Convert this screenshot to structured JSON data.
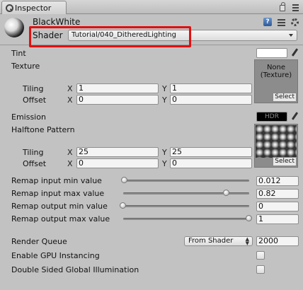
{
  "tab": {
    "title": "Inspector",
    "icon": "inspector-icon"
  },
  "material": {
    "name": "BlackWhite",
    "shader_label": "Shader",
    "shader_value": "Tutorial/040_DitheredLighting"
  },
  "properties": {
    "tint": {
      "label": "Tint",
      "color": "#ffffff"
    },
    "texture": {
      "label": "Texture",
      "slot_text": "None\n(Texture)",
      "select_label": "Select",
      "tiling_label": "Tiling",
      "tiling_x": "1",
      "tiling_y": "1",
      "offset_label": "Offset",
      "offset_x": "0",
      "offset_y": "0"
    },
    "emission": {
      "label": "Emission",
      "hdr_text": "HDR",
      "color": "#000000"
    },
    "halftone": {
      "label": "Halftone Pattern",
      "select_label": "Select",
      "tiling_label": "Tiling",
      "tiling_x": "25",
      "tiling_y": "25",
      "offset_label": "Offset",
      "offset_x": "0",
      "offset_y": "0"
    },
    "axis_x": "X",
    "axis_y": "Y",
    "sliders": [
      {
        "label": "Remap input min value",
        "value": "0.012",
        "fraction": 0.012
      },
      {
        "label": "Remap input max value",
        "value": "0.82",
        "fraction": 0.82
      },
      {
        "label": "Remap output min value",
        "value": "0",
        "fraction": 0.0
      },
      {
        "label": "Remap output max value",
        "value": "1",
        "fraction": 1.0
      }
    ],
    "render_queue": {
      "label": "Render Queue",
      "mode": "From Shader",
      "value": "2000"
    },
    "gpu_instancing": {
      "label": "Enable GPU Instancing",
      "checked": false
    },
    "double_sided_gi": {
      "label": "Double Sided Global Illumination",
      "checked": false
    }
  },
  "colors": {
    "panel": "#c2c2c2",
    "highlight": "#e01010"
  }
}
